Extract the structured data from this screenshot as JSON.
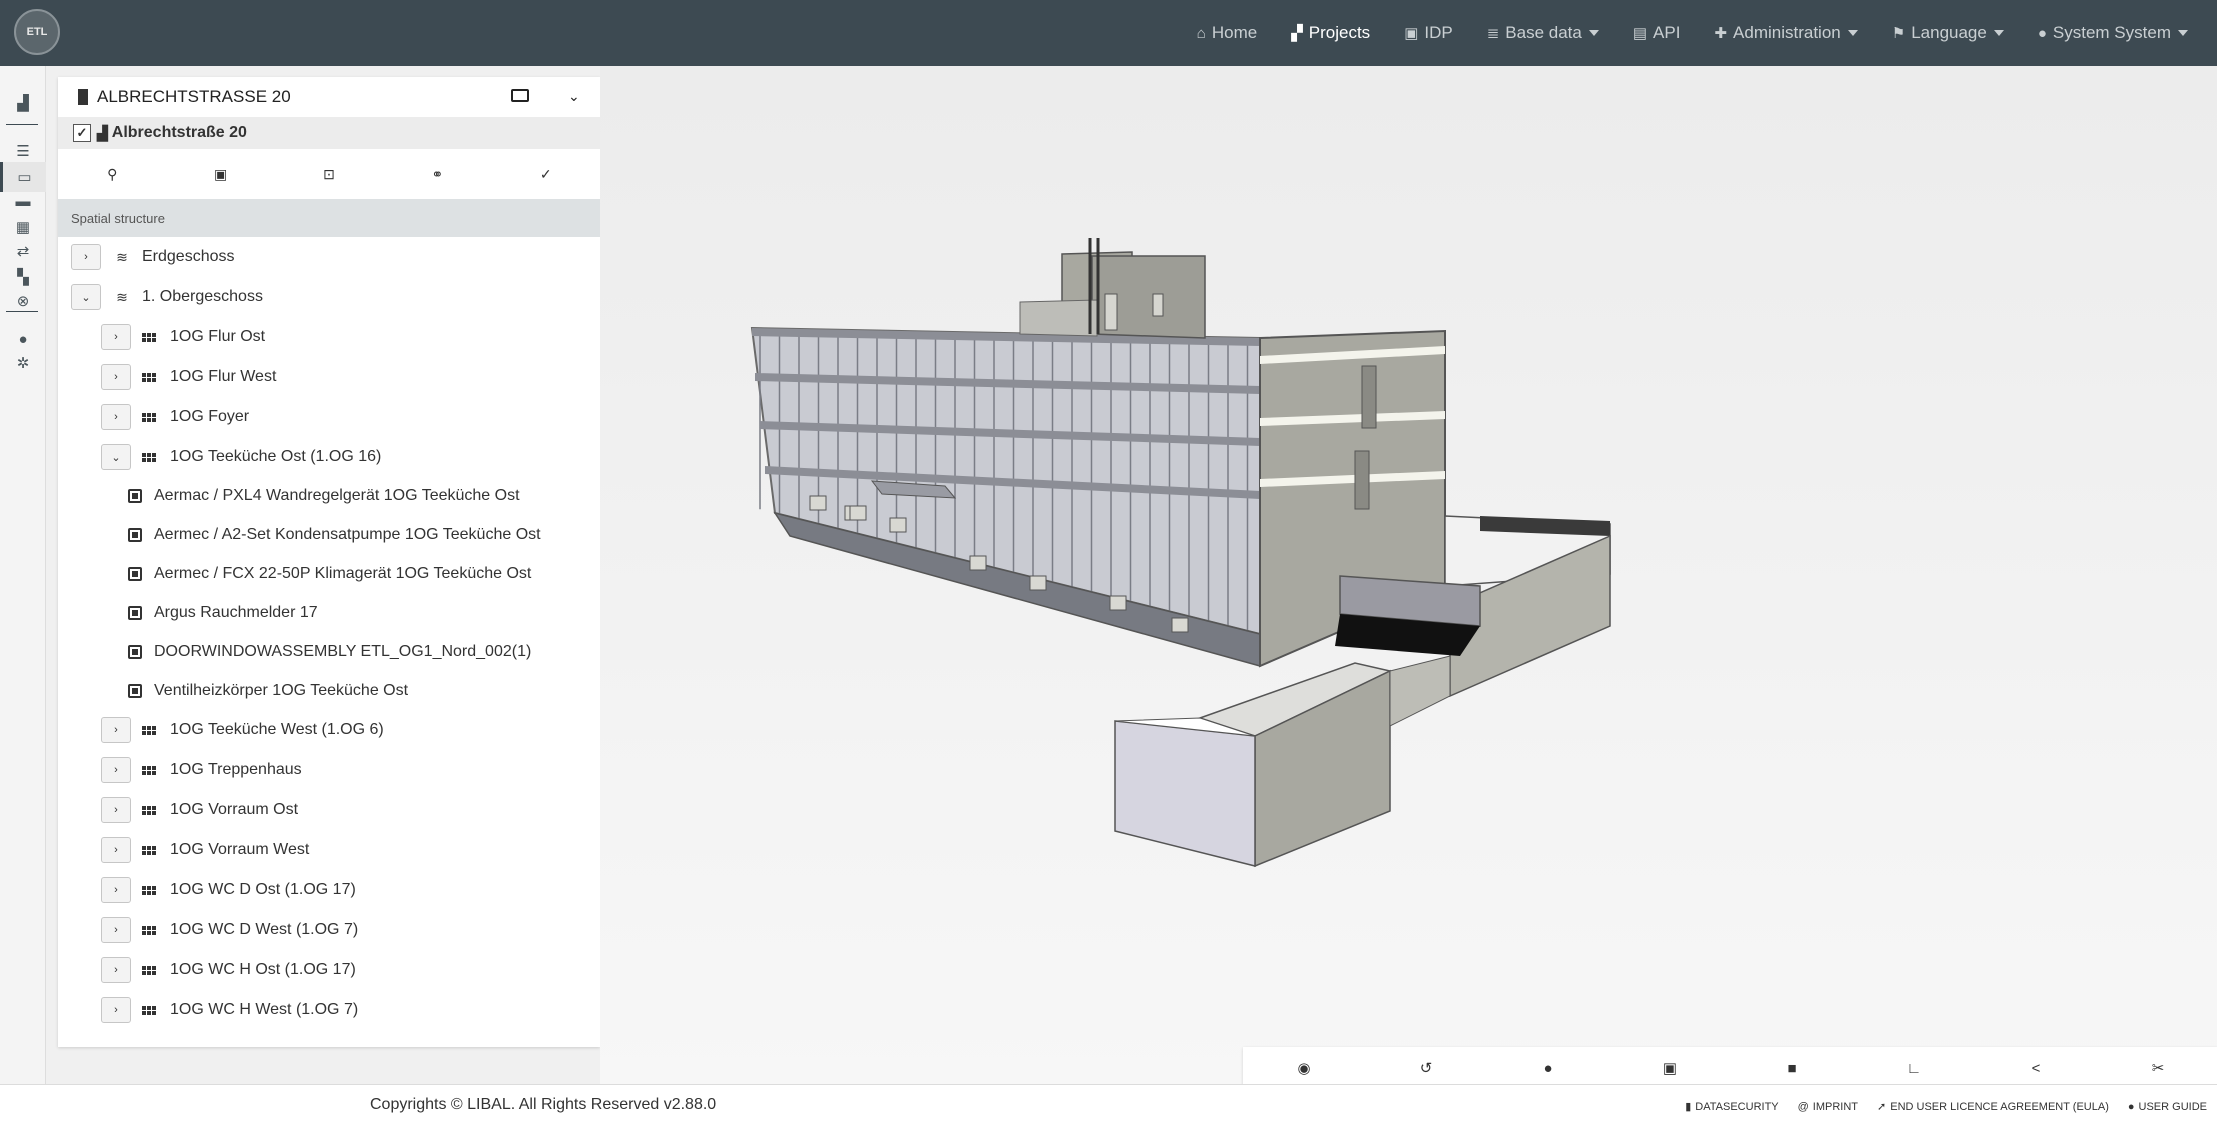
{
  "logo": {
    "text": "ETL"
  },
  "nav": {
    "items": [
      {
        "name": "nav-home",
        "icon": "home-icon",
        "glyph": "⌂",
        "label": "Home",
        "dropdown": false,
        "active": false
      },
      {
        "name": "nav-projects",
        "icon": "projects-icon",
        "glyph": "▞",
        "label": "Projects",
        "dropdown": false,
        "active": true
      },
      {
        "name": "nav-idp",
        "icon": "idp-icon",
        "glyph": "▣",
        "label": "IDP",
        "dropdown": false,
        "active": false
      },
      {
        "name": "nav-base-data",
        "icon": "database-icon",
        "glyph": "≣",
        "label": "Base data",
        "dropdown": true,
        "active": false
      },
      {
        "name": "nav-api",
        "icon": "book-icon",
        "glyph": "▤",
        "label": "API",
        "dropdown": false,
        "active": false
      },
      {
        "name": "nav-administration",
        "icon": "user-plus-icon",
        "glyph": "✚",
        "label": "Administration",
        "dropdown": true,
        "active": false
      },
      {
        "name": "nav-language",
        "icon": "flag-icon",
        "glyph": "⚑",
        "label": "Language",
        "dropdown": true,
        "active": false
      },
      {
        "name": "nav-user",
        "icon": "user-icon",
        "glyph": "●",
        "label": "System System",
        "dropdown": true,
        "active": false
      }
    ]
  },
  "rail": {
    "items": [
      {
        "name": "rail-projects",
        "icon": "projects-icon",
        "glyph": "▟"
      },
      {
        "name": "rail-list",
        "icon": "list-icon",
        "glyph": "☰"
      },
      {
        "name": "rail-viewer",
        "icon": "monitor-icon",
        "glyph": "▭"
      },
      {
        "name": "rail-storage",
        "icon": "archive-icon",
        "glyph": "▬"
      },
      {
        "name": "rail-calendar",
        "icon": "calendar-icon",
        "glyph": "▦"
      },
      {
        "name": "rail-exchange",
        "icon": "exchange-icon",
        "glyph": "⇄"
      },
      {
        "name": "rail-dashboard",
        "icon": "dashboard-icon",
        "glyph": "▚"
      },
      {
        "name": "rail-support",
        "icon": "support-icon",
        "glyph": "⊗"
      },
      {
        "name": "rail-user",
        "icon": "user-icon",
        "glyph": "●"
      },
      {
        "name": "rail-settings",
        "icon": "gear-icon",
        "glyph": "✲"
      }
    ]
  },
  "panel": {
    "title": "ALBRECHTSTRASSE 20",
    "model_name": "Albrechtstraße 20",
    "model_checked": "✓",
    "tools": [
      {
        "name": "search-tool-button",
        "icon": "search-icon",
        "glyph": "⚲"
      },
      {
        "name": "properties-tool-button",
        "icon": "contact-card-icon",
        "glyph": "▣"
      },
      {
        "name": "select-area-tool-button",
        "icon": "vector-square-icon",
        "glyph": "⊡"
      },
      {
        "name": "people-tool-button",
        "icon": "people-icon",
        "glyph": "⚭"
      },
      {
        "name": "checklist-tool-button",
        "icon": "clipboard-check-icon",
        "glyph": "✓"
      }
    ],
    "section_title": "Spatial structure",
    "tree": [
      {
        "level": 0,
        "kind": "storey",
        "toggle": "›",
        "label": "Erdgeschoss"
      },
      {
        "level": 0,
        "kind": "storey",
        "toggle": "⌄",
        "label": "1. Obergeschoss"
      },
      {
        "level": 1,
        "kind": "space",
        "toggle": "›",
        "label": "1OG Flur Ost"
      },
      {
        "level": 1,
        "kind": "space",
        "toggle": "›",
        "label": "1OG Flur West"
      },
      {
        "level": 1,
        "kind": "space",
        "toggle": "›",
        "label": "1OG Foyer"
      },
      {
        "level": 1,
        "kind": "space",
        "toggle": "⌄",
        "label": "1OG Teeküche Ost (1.OG 16)"
      },
      {
        "level": 2,
        "kind": "element",
        "toggle": "",
        "label": "Aermac / PXL4 Wandregelgerät 1OG Teeküche Ost"
      },
      {
        "level": 2,
        "kind": "element",
        "toggle": "",
        "label": "Aermec / A2-Set Kondensatpumpe 1OG Teeküche Ost"
      },
      {
        "level": 2,
        "kind": "element",
        "toggle": "",
        "label": "Aermec / FCX 22-50P Klimagerät 1OG Teeküche Ost"
      },
      {
        "level": 2,
        "kind": "element",
        "toggle": "",
        "label": "Argus Rauchmelder 17"
      },
      {
        "level": 2,
        "kind": "element",
        "toggle": "",
        "label": "DOORWINDOWASSEMBLY ETL_OG1_Nord_002(1)"
      },
      {
        "level": 2,
        "kind": "element",
        "toggle": "",
        "label": "Ventilheizkörper 1OG Teeküche Ost"
      },
      {
        "level": 1,
        "kind": "space",
        "toggle": "›",
        "label": "1OG Teeküche West (1.OG 6)"
      },
      {
        "level": 1,
        "kind": "space",
        "toggle": "›",
        "label": "1OG Treppenhaus"
      },
      {
        "level": 1,
        "kind": "space",
        "toggle": "›",
        "label": "1OG Vorraum Ost"
      },
      {
        "level": 1,
        "kind": "space",
        "toggle": "›",
        "label": "1OG Vorraum West"
      },
      {
        "level": 1,
        "kind": "space",
        "toggle": "›",
        "label": "1OG WC D Ost (1.OG 17)"
      },
      {
        "level": 1,
        "kind": "space",
        "toggle": "›",
        "label": "1OG WC D West (1.OG 7)"
      },
      {
        "level": 1,
        "kind": "space",
        "toggle": "›",
        "label": "1OG WC H Ost (1.OG 17)"
      },
      {
        "level": 1,
        "kind": "space",
        "toggle": "›",
        "label": "1OG WC H West (1.OG 7)"
      }
    ]
  },
  "viewer_toolbar": [
    {
      "name": "visibility-button",
      "icon": "eye-icon",
      "glyph": "◉"
    },
    {
      "name": "reset-view-button",
      "icon": "undo-icon",
      "glyph": "↺"
    },
    {
      "name": "orbit-button",
      "icon": "circle-icon",
      "glyph": "●"
    },
    {
      "name": "section-box-button",
      "icon": "section-box-icon",
      "glyph": "▣"
    },
    {
      "name": "camera-button",
      "icon": "video-camera-icon",
      "glyph": "■"
    },
    {
      "name": "measure-angle-button",
      "icon": "angle-icon",
      "glyph": "∟"
    },
    {
      "name": "share-button",
      "icon": "chevron-left-icon",
      "glyph": "<"
    },
    {
      "name": "cut-button",
      "icon": "scissors-icon",
      "glyph": "✂"
    }
  ],
  "footer": {
    "copyright": "Copyrights © LIBAL. All Rights Reserved  v2.88.0",
    "links": [
      {
        "name": "datasecurity-link",
        "icon": "lock-icon",
        "glyph": "▮",
        "label": "DATASECURITY"
      },
      {
        "name": "imprint-link",
        "icon": "at-icon",
        "glyph": "@",
        "label": "IMPRINT"
      },
      {
        "name": "eula-link",
        "icon": "pointer-icon",
        "glyph": "➚",
        "label": "END USER LICENCE AGREEMENT (EULA)"
      },
      {
        "name": "user-guide-link",
        "icon": "user-icon",
        "glyph": "●",
        "label": "USER GUIDE"
      }
    ]
  },
  "colors": {
    "navbar": "#3d4a52",
    "panel_section": "#dde1e3",
    "rail": "#f4f4f4"
  }
}
